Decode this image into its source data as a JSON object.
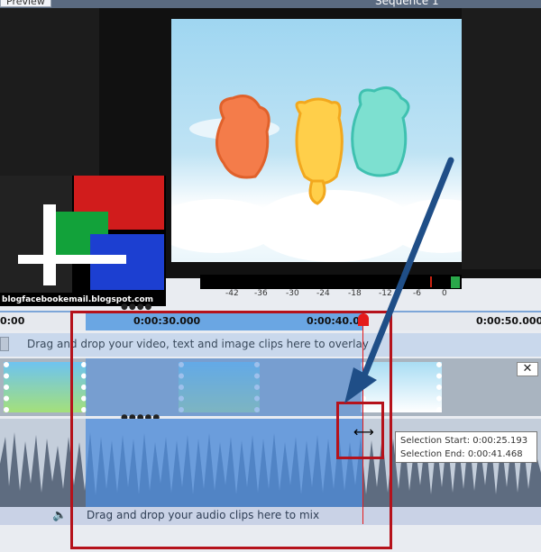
{
  "tabs": {
    "preview": "Preview",
    "sequence": "Sequence 1"
  },
  "logo": {
    "caption": "blogfacebookemail.blogspot.com"
  },
  "meter": {
    "scale": [
      "-42",
      "-36",
      "-30",
      "-24",
      "-18",
      "-12",
      "-6",
      "0"
    ]
  },
  "ruler": {
    "marks": [
      "0:00",
      "0:00:30.000",
      "0:00:40.0",
      "0:00:50.000"
    ]
  },
  "overlay_track": {
    "text": "Drag and drop your video, text and image clips here to overlay"
  },
  "audio_track": {
    "text": "Drag and drop your audio clips here to mix"
  },
  "tooltip": {
    "start": "Selection Start: 0:00:25.193",
    "end": "Selection End: 0:00:41.468"
  },
  "icons": [
    "speaker-icon",
    "close-icon",
    "resize-cursor-icon",
    "pointer-arrow"
  ],
  "colors": {
    "selection": "#4e8cdc",
    "playhead": "#e51b1b",
    "annotation": "#b5121b",
    "arrow": "#1f4e87"
  }
}
